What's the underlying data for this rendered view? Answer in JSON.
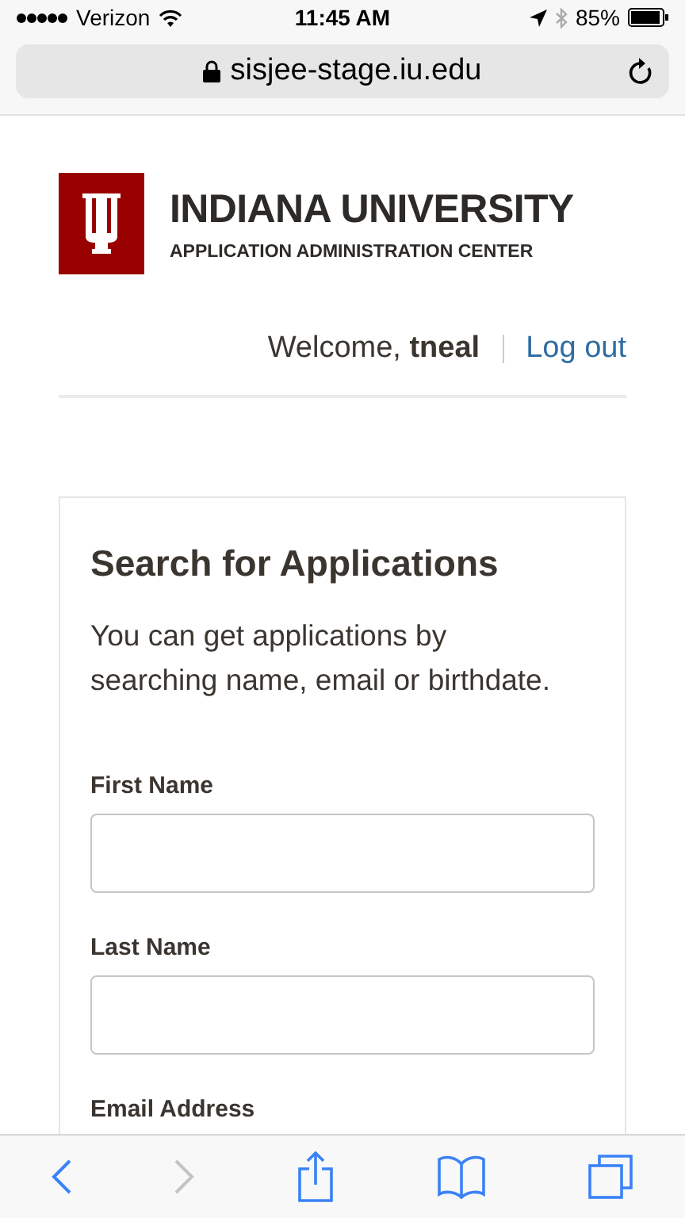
{
  "status_bar": {
    "carrier": "Verizon",
    "time": "11:45 AM",
    "battery": "85%"
  },
  "address_bar": {
    "url": "sisjee-stage.iu.edu"
  },
  "header": {
    "title": "INDIANA UNIVERSITY",
    "subtitle": "APPLICATION ADMINISTRATION CENTER",
    "welcome": "Welcome, **tneal**",
    "logout": "Log out"
  },
  "search_card": {
    "title": "Search for Applications",
    "description": "You can get applications by searching name, email or birthdate.",
    "fields": [
      {
        "kind": "text",
        "label": "First Name"
      },
      {
        "kind": "text",
        "label": "Last Name"
      },
      {
        "kind": "label_only",
        "label": "Email Address"
      }
    ]
  },
  "toolbar": [
    {
      "kind": "back",
      "disabled": false
    },
    {
      "kind": "forward",
      "disabled": true
    },
    {
      "kind": "share",
      "disabled": false
    },
    {
      "kind": "bookmarks",
      "disabled": false
    },
    {
      "kind": "tabs",
      "disabled": false
    }
  ]
}
